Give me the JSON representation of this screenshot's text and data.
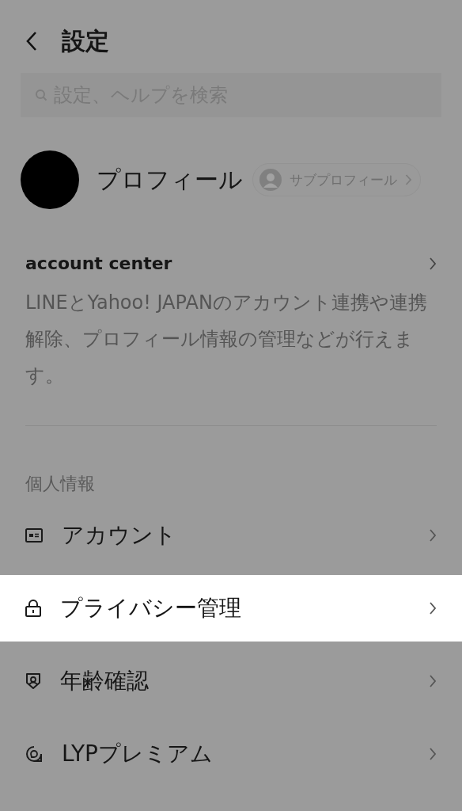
{
  "header": {
    "title": "設定"
  },
  "search": {
    "placeholder": "設定、ヘルプを検索"
  },
  "profile": {
    "name": "プロフィール",
    "sub_profile_button": "サブプロフィール"
  },
  "account_center": {
    "title": "account center",
    "description": "LINEとYahoo! JAPANのアカウント連携や連携解除、プロフィール情報の管理などが行えます。"
  },
  "section": {
    "title": "個人情報",
    "items": [
      {
        "kind": "account",
        "label": "アカウント",
        "selected": false
      },
      {
        "kind": "privacy",
        "label": "プライバシー管理",
        "selected": true
      },
      {
        "kind": "age",
        "label": "年齢確認",
        "selected": false
      },
      {
        "kind": "premium",
        "label": "LYPプレミアム",
        "selected": false
      }
    ]
  }
}
